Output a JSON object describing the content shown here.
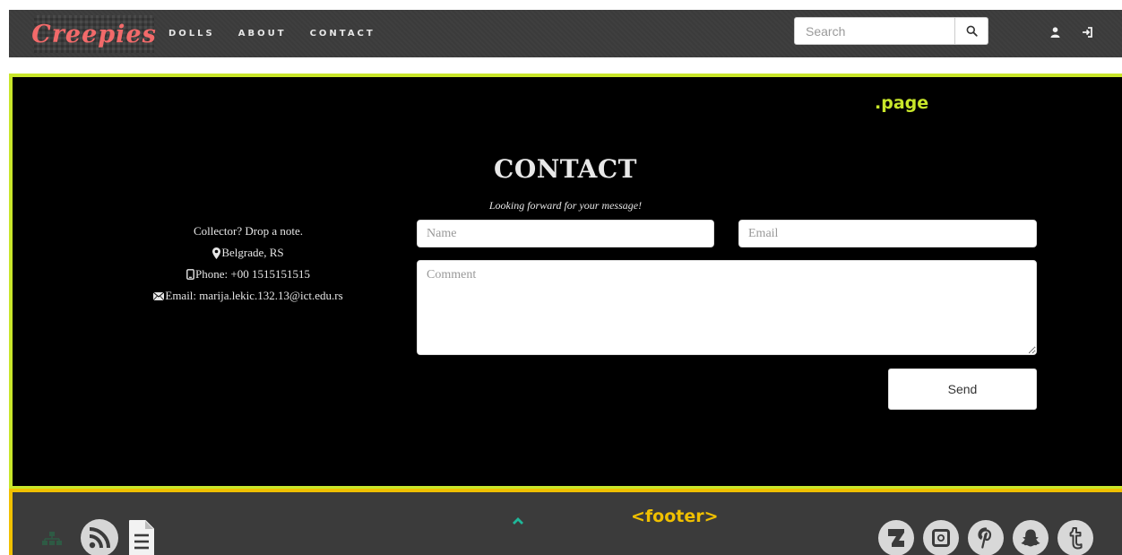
{
  "brand": {
    "logo_text": "Creepies"
  },
  "nav": {
    "links": [
      {
        "label": "DOLLS"
      },
      {
        "label": "ABOUT"
      },
      {
        "label": "CONTACT"
      }
    ],
    "search": {
      "placeholder": "Search"
    },
    "icons": [
      "search-icon",
      "user-icon",
      "login-icon"
    ]
  },
  "page": {
    "debug_label": ".page",
    "title": "CONTACT",
    "subtitle": "Looking forward for your message!",
    "info": {
      "tagline": "Collector? Drop a note.",
      "location": "Belgrade, RS",
      "phone": "Phone: +00 1515151515",
      "email": "Email: marija.lekic.132.13@ict.edu.rs"
    },
    "form": {
      "name_placeholder": "Name",
      "email_placeholder": "Email",
      "comment_placeholder": "Comment",
      "send_label": "Send"
    }
  },
  "footer": {
    "debug_label": "<footer>",
    "left_icons": [
      "sitemap-icon",
      "rss-icon",
      "document-icon"
    ],
    "center_icon": "chevron-up-icon",
    "social_icons": [
      "deviantart-icon",
      "instagram-icon",
      "pinterest-icon",
      "snapchat-icon",
      "tumblr-icon"
    ]
  },
  "colors": {
    "page_outline": "#c8e62a",
    "footer_outline": "#f0c000",
    "logo": "#f26a6a",
    "navbar_bg": "#3b3b3b",
    "page_bg": "#000000",
    "accent_up": "#1fb89a"
  }
}
